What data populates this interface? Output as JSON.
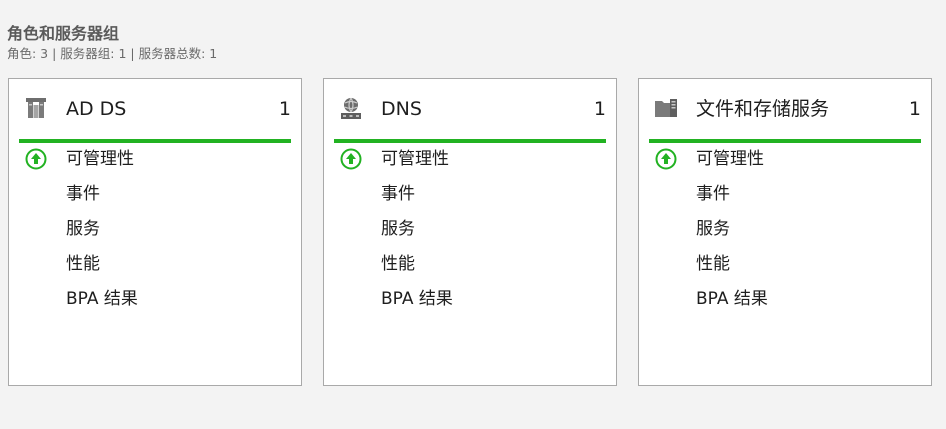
{
  "header": {
    "title": "角色和服务器组",
    "subtitle": "角色: 3 | 服务器组: 1 | 服务器总数: 1"
  },
  "colors": {
    "status_green": "#22b222",
    "accent_bar": "#22b222"
  },
  "tiles": [
    {
      "icon": "ad-ds-icon",
      "title": "AD DS",
      "count": "1",
      "rows": {
        "manageability": "可管理性",
        "events": "事件",
        "services": "服务",
        "performance": "性能",
        "bpa": "BPA 结果"
      }
    },
    {
      "icon": "dns-icon",
      "title": "DNS",
      "count": "1",
      "rows": {
        "manageability": "可管理性",
        "events": "事件",
        "services": "服务",
        "performance": "性能",
        "bpa": "BPA 结果"
      }
    },
    {
      "icon": "file-storage-icon",
      "title": "文件和存储服务",
      "count": "1",
      "rows": {
        "manageability": "可管理性",
        "events": "事件",
        "services": "服务",
        "performance": "性能",
        "bpa": "BPA 结果"
      }
    }
  ]
}
